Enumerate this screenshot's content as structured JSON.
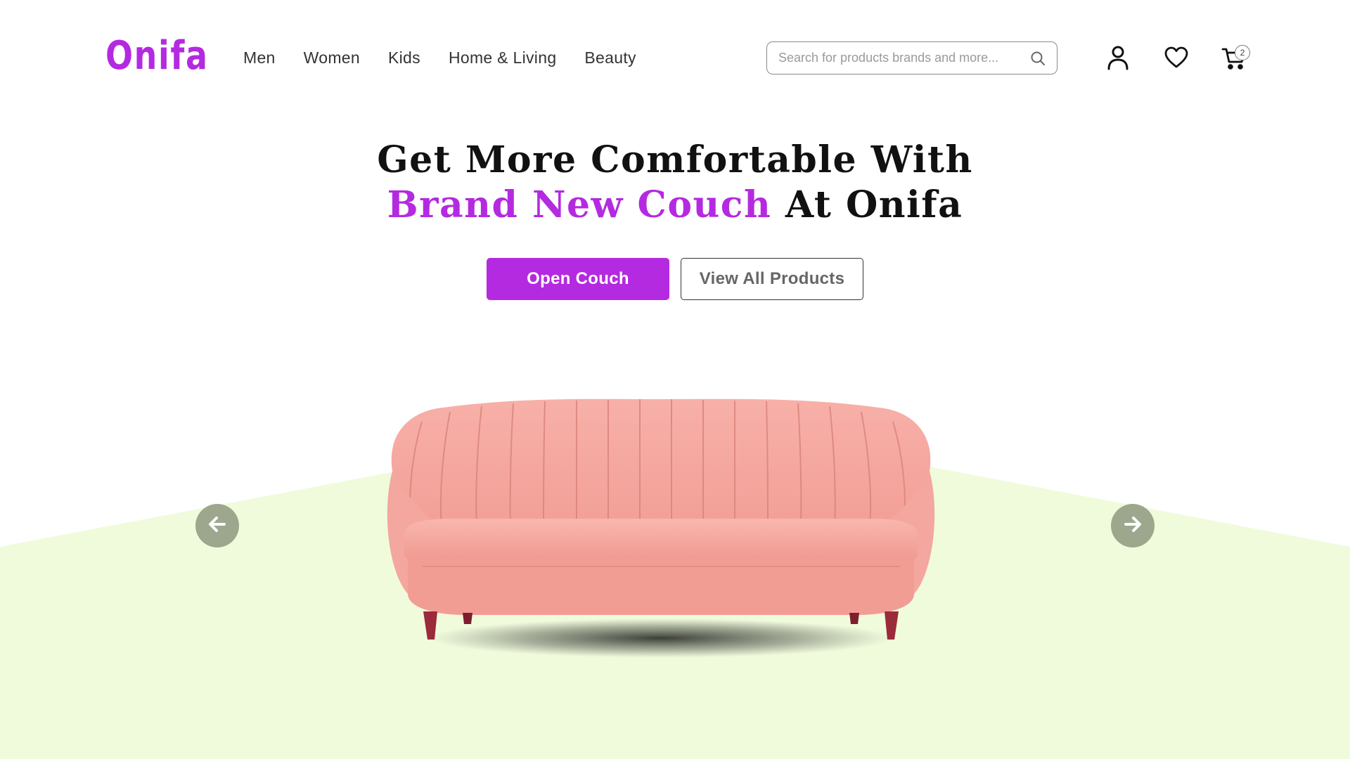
{
  "brand": {
    "name": "Onifa",
    "color": "#b42ae0"
  },
  "nav": {
    "items": [
      {
        "label": "Men"
      },
      {
        "label": "Women"
      },
      {
        "label": "Kids"
      },
      {
        "label": "Home & Living"
      },
      {
        "label": "Beauty"
      }
    ]
  },
  "search": {
    "placeholder": "Search for products brands and more...",
    "value": ""
  },
  "header_icons": {
    "user": "user-icon",
    "wishlist": "heart-icon",
    "cart": "cart-icon",
    "cart_count": "2"
  },
  "hero": {
    "title_line1": "Get More Comfortable With",
    "title_accent": "Brand New Couch",
    "title_rest": " At Onifa",
    "primary_button": "Open Couch",
    "secondary_button": "View All Products"
  },
  "carousel": {
    "prev_icon": "arrow-left-icon",
    "next_icon": "arrow-right-icon"
  },
  "colors": {
    "accent": "#b42ae0",
    "floor": "#f0fbdc",
    "arrow_bg": "#9ca78e",
    "couch": "#f4a39b"
  }
}
